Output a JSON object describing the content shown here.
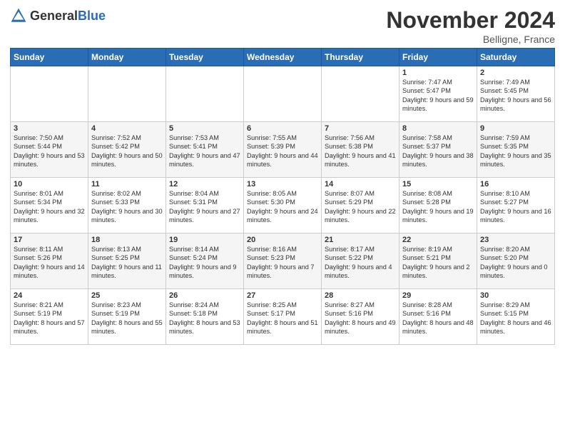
{
  "header": {
    "logo_general": "General",
    "logo_blue": "Blue",
    "month_title": "November 2024",
    "location": "Belligne, France"
  },
  "weekdays": [
    "Sunday",
    "Monday",
    "Tuesday",
    "Wednesday",
    "Thursday",
    "Friday",
    "Saturday"
  ],
  "weeks": [
    [
      {
        "day": "",
        "info": ""
      },
      {
        "day": "",
        "info": ""
      },
      {
        "day": "",
        "info": ""
      },
      {
        "day": "",
        "info": ""
      },
      {
        "day": "",
        "info": ""
      },
      {
        "day": "1",
        "info": "Sunrise: 7:47 AM\nSunset: 5:47 PM\nDaylight: 9 hours and 59 minutes."
      },
      {
        "day": "2",
        "info": "Sunrise: 7:49 AM\nSunset: 5:45 PM\nDaylight: 9 hours and 56 minutes."
      }
    ],
    [
      {
        "day": "3",
        "info": "Sunrise: 7:50 AM\nSunset: 5:44 PM\nDaylight: 9 hours and 53 minutes."
      },
      {
        "day": "4",
        "info": "Sunrise: 7:52 AM\nSunset: 5:42 PM\nDaylight: 9 hours and 50 minutes."
      },
      {
        "day": "5",
        "info": "Sunrise: 7:53 AM\nSunset: 5:41 PM\nDaylight: 9 hours and 47 minutes."
      },
      {
        "day": "6",
        "info": "Sunrise: 7:55 AM\nSunset: 5:39 PM\nDaylight: 9 hours and 44 minutes."
      },
      {
        "day": "7",
        "info": "Sunrise: 7:56 AM\nSunset: 5:38 PM\nDaylight: 9 hours and 41 minutes."
      },
      {
        "day": "8",
        "info": "Sunrise: 7:58 AM\nSunset: 5:37 PM\nDaylight: 9 hours and 38 minutes."
      },
      {
        "day": "9",
        "info": "Sunrise: 7:59 AM\nSunset: 5:35 PM\nDaylight: 9 hours and 35 minutes."
      }
    ],
    [
      {
        "day": "10",
        "info": "Sunrise: 8:01 AM\nSunset: 5:34 PM\nDaylight: 9 hours and 32 minutes."
      },
      {
        "day": "11",
        "info": "Sunrise: 8:02 AM\nSunset: 5:33 PM\nDaylight: 9 hours and 30 minutes."
      },
      {
        "day": "12",
        "info": "Sunrise: 8:04 AM\nSunset: 5:31 PM\nDaylight: 9 hours and 27 minutes."
      },
      {
        "day": "13",
        "info": "Sunrise: 8:05 AM\nSunset: 5:30 PM\nDaylight: 9 hours and 24 minutes."
      },
      {
        "day": "14",
        "info": "Sunrise: 8:07 AM\nSunset: 5:29 PM\nDaylight: 9 hours and 22 minutes."
      },
      {
        "day": "15",
        "info": "Sunrise: 8:08 AM\nSunset: 5:28 PM\nDaylight: 9 hours and 19 minutes."
      },
      {
        "day": "16",
        "info": "Sunrise: 8:10 AM\nSunset: 5:27 PM\nDaylight: 9 hours and 16 minutes."
      }
    ],
    [
      {
        "day": "17",
        "info": "Sunrise: 8:11 AM\nSunset: 5:26 PM\nDaylight: 9 hours and 14 minutes."
      },
      {
        "day": "18",
        "info": "Sunrise: 8:13 AM\nSunset: 5:25 PM\nDaylight: 9 hours and 11 minutes."
      },
      {
        "day": "19",
        "info": "Sunrise: 8:14 AM\nSunset: 5:24 PM\nDaylight: 9 hours and 9 minutes."
      },
      {
        "day": "20",
        "info": "Sunrise: 8:16 AM\nSunset: 5:23 PM\nDaylight: 9 hours and 7 minutes."
      },
      {
        "day": "21",
        "info": "Sunrise: 8:17 AM\nSunset: 5:22 PM\nDaylight: 9 hours and 4 minutes."
      },
      {
        "day": "22",
        "info": "Sunrise: 8:19 AM\nSunset: 5:21 PM\nDaylight: 9 hours and 2 minutes."
      },
      {
        "day": "23",
        "info": "Sunrise: 8:20 AM\nSunset: 5:20 PM\nDaylight: 9 hours and 0 minutes."
      }
    ],
    [
      {
        "day": "24",
        "info": "Sunrise: 8:21 AM\nSunset: 5:19 PM\nDaylight: 8 hours and 57 minutes."
      },
      {
        "day": "25",
        "info": "Sunrise: 8:23 AM\nSunset: 5:19 PM\nDaylight: 8 hours and 55 minutes."
      },
      {
        "day": "26",
        "info": "Sunrise: 8:24 AM\nSunset: 5:18 PM\nDaylight: 8 hours and 53 minutes."
      },
      {
        "day": "27",
        "info": "Sunrise: 8:25 AM\nSunset: 5:17 PM\nDaylight: 8 hours and 51 minutes."
      },
      {
        "day": "28",
        "info": "Sunrise: 8:27 AM\nSunset: 5:16 PM\nDaylight: 8 hours and 49 minutes."
      },
      {
        "day": "29",
        "info": "Sunrise: 8:28 AM\nSunset: 5:16 PM\nDaylight: 8 hours and 48 minutes."
      },
      {
        "day": "30",
        "info": "Sunrise: 8:29 AM\nSunset: 5:15 PM\nDaylight: 8 hours and 46 minutes."
      }
    ]
  ]
}
